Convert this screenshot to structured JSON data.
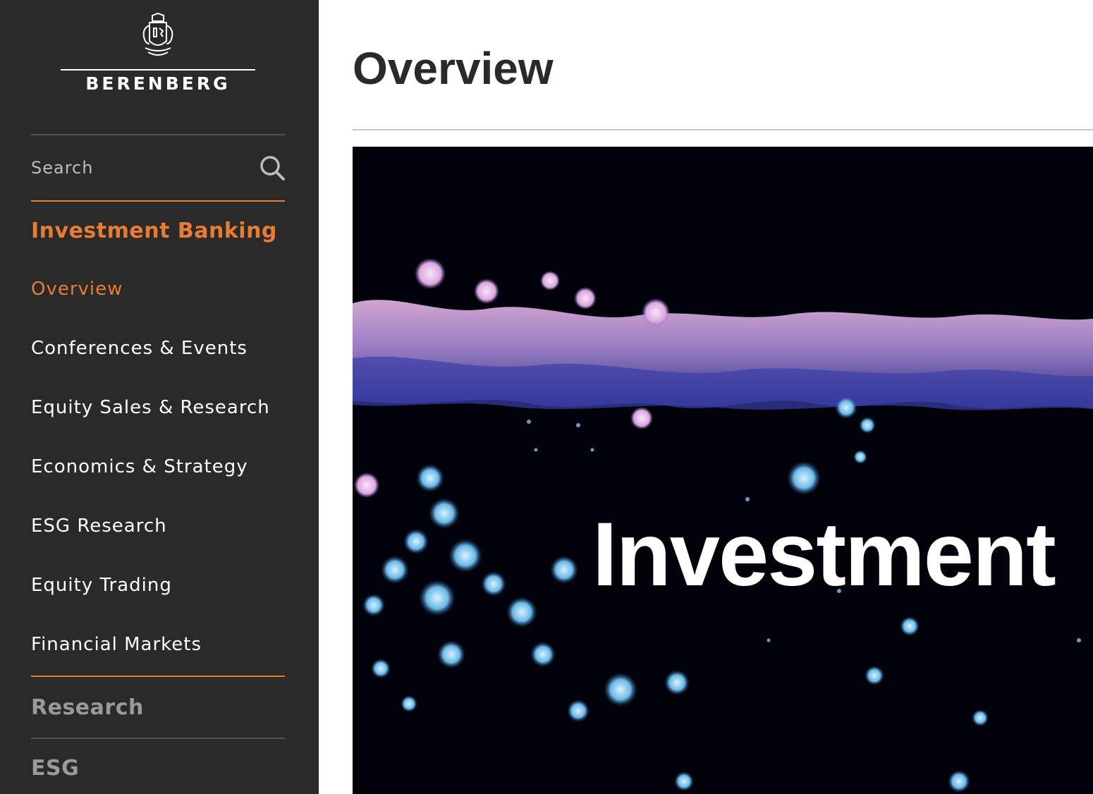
{
  "brand": {
    "name": "BERENBERG",
    "crest_icon": "coat-of-arms-icon"
  },
  "colors": {
    "sidebar_bg": "#2a2a2a",
    "accent": "#e87c34",
    "muted": "#9a9a9a",
    "title": "#2a2a2a"
  },
  "search": {
    "placeholder": "Search",
    "icon": "search-icon"
  },
  "nav": {
    "section_active": "Investment Banking",
    "items": [
      "Overview",
      "Conferences & Events",
      "Equity Sales & Research",
      "Economics & Strategy",
      "ESG Research",
      "Equity Trading",
      "Financial Markets"
    ],
    "current_item": "Overview",
    "sections_other": [
      "Research",
      "ESG"
    ]
  },
  "main": {
    "title": "Overview",
    "hero_text": "Investment"
  }
}
